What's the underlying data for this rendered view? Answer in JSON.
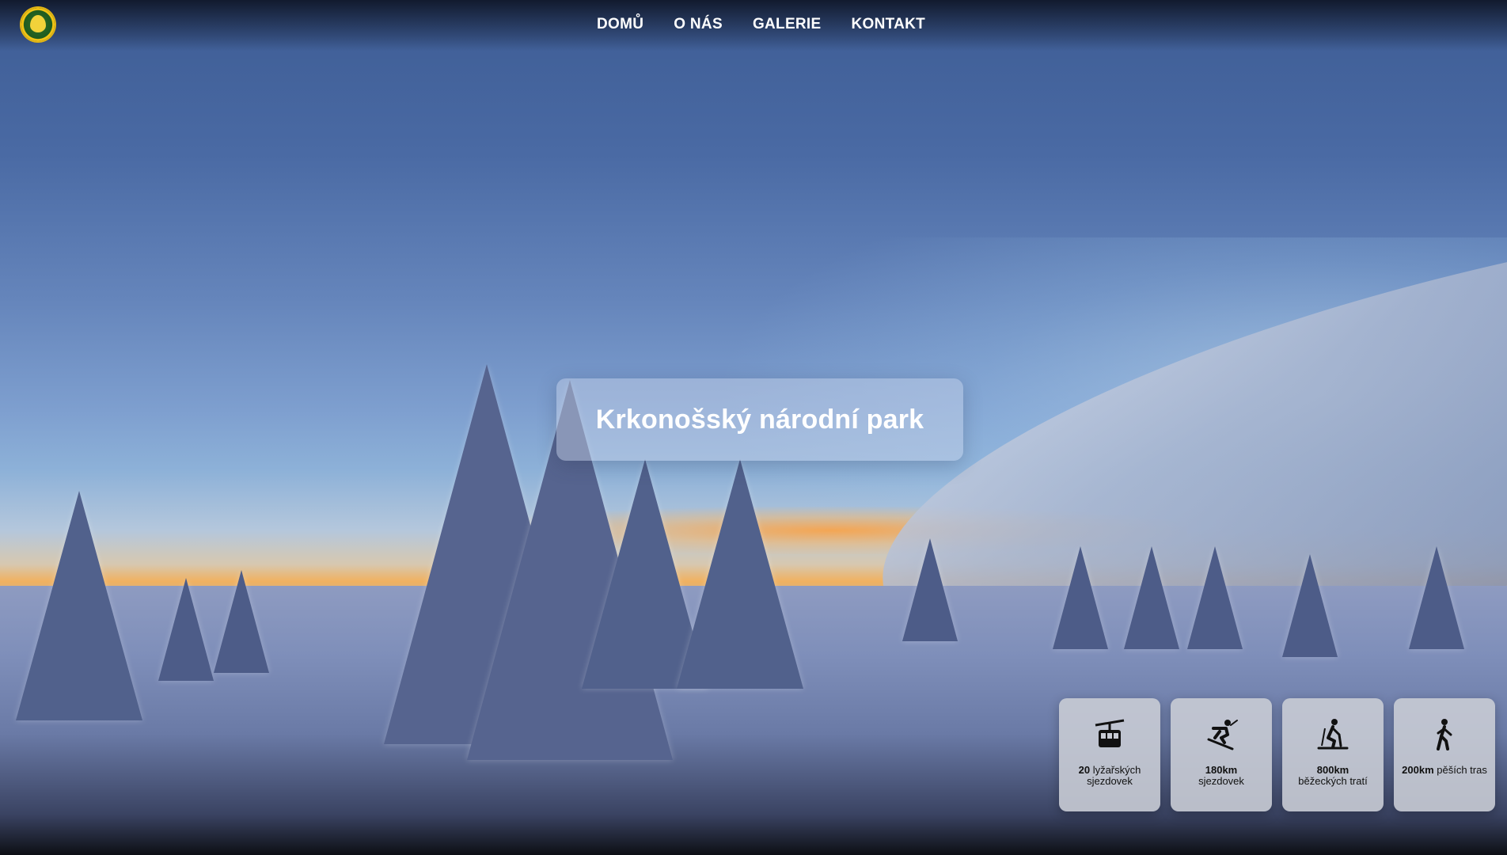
{
  "header": {
    "nav": [
      "DOMŮ",
      "O NÁS",
      "GALERIE",
      "KONTAKT"
    ]
  },
  "hero": {
    "title": "Krkonošský národní park"
  },
  "stats": [
    {
      "icon": "cable-car-icon",
      "number": "20",
      "label": " lyžařských sjezdovek"
    },
    {
      "icon": "downhill-skier-icon",
      "number": "180km",
      "label": " sjezdovek"
    },
    {
      "icon": "cross-country-skier-icon",
      "number": "800km",
      "label": " běžeckých tratí"
    },
    {
      "icon": "hiker-icon",
      "number": "200km",
      "label": " pěších tras"
    }
  ],
  "colors": {
    "card_bg": "#c8cbd4",
    "nav_text": "#ffffff",
    "logo_green": "#1e5b1f",
    "logo_yellow": "#f2c414"
  }
}
